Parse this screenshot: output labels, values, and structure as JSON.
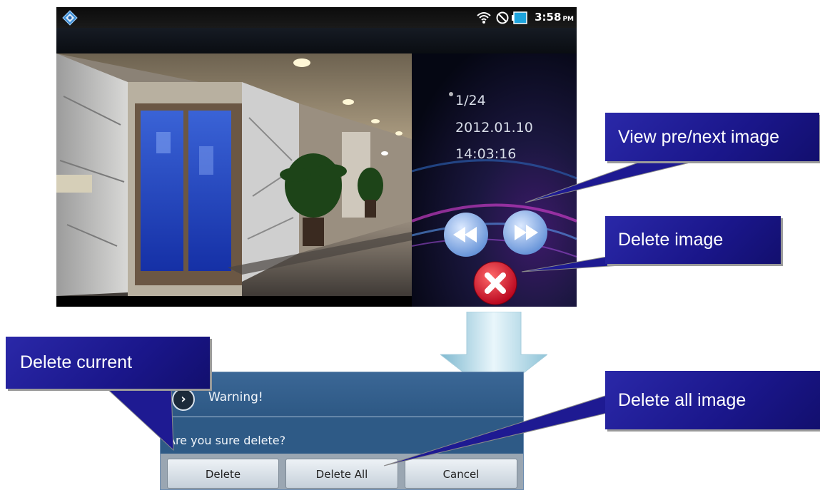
{
  "status_bar": {
    "time": "3:58",
    "ampm": "PM",
    "icons": [
      "wifi-icon",
      "blocked-icon",
      "battery-icon"
    ]
  },
  "image_info": {
    "index": "1/24",
    "date": "2012.01.10",
    "time": "14:03:16"
  },
  "callouts": {
    "view_prev_next": "View pre/next image",
    "delete_image": "Delete image",
    "delete_current": "Delete current",
    "delete_all": "Delete all image"
  },
  "dialog": {
    "title": "Warning!",
    "message": "Are you sure delete?",
    "buttons": {
      "delete": "Delete",
      "delete_all": "Delete All",
      "cancel": "Cancel"
    }
  },
  "colors": {
    "callout_bg": "#1a168a",
    "dialog_bg": "#2e5a86",
    "delete_red": "#c8102e"
  }
}
